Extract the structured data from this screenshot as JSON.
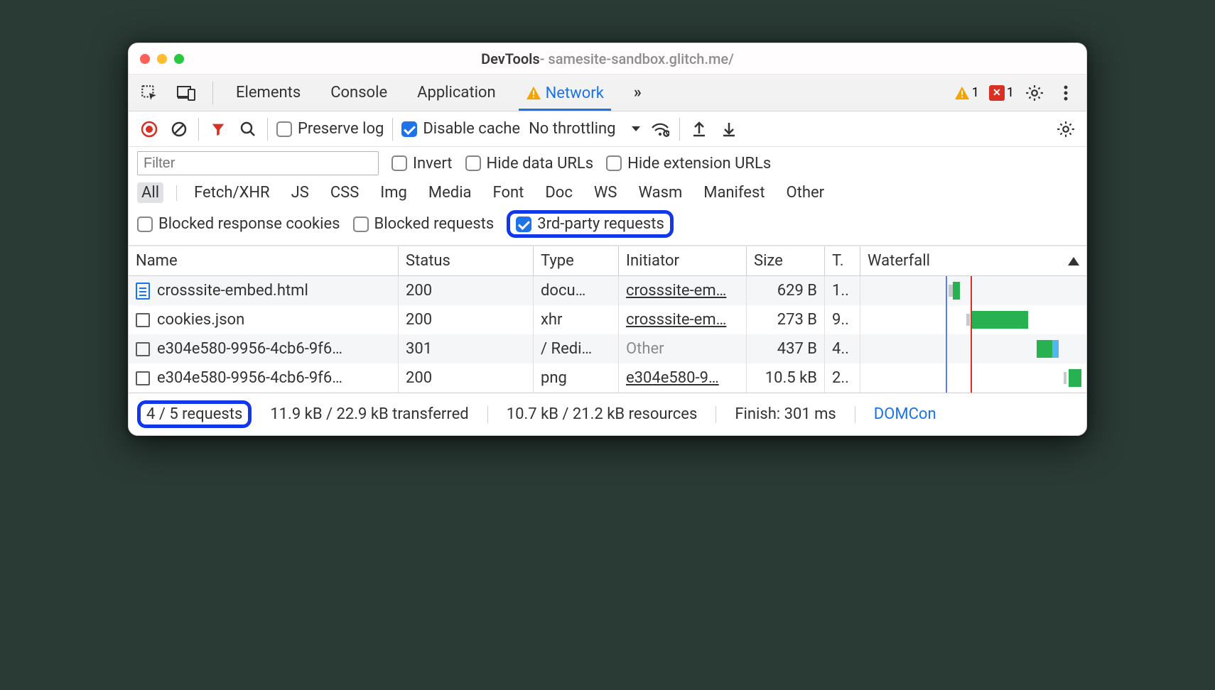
{
  "title": {
    "strong": "DevTools",
    "rest": " - samesite-sandbox.glitch.me/"
  },
  "tabs": {
    "elements": "Elements",
    "console": "Console",
    "application": "Application",
    "network": "Network",
    "more": "»"
  },
  "badges": {
    "warn_count": "1",
    "err_count": "1"
  },
  "net_toolbar": {
    "preserve_log": "Preserve log",
    "disable_cache": "Disable cache",
    "throttling": "No throttling"
  },
  "filter": {
    "placeholder": "Filter",
    "invert": "Invert",
    "hide_data": "Hide data URLs",
    "hide_ext": "Hide extension URLs",
    "types": [
      "All",
      "Fetch/XHR",
      "JS",
      "CSS",
      "Img",
      "Media",
      "Font",
      "Doc",
      "WS",
      "Wasm",
      "Manifest",
      "Other"
    ],
    "blocked_cookies": "Blocked response cookies",
    "blocked_req": "Blocked requests",
    "third_party": "3rd-party requests"
  },
  "headers": {
    "name": "Name",
    "status": "Status",
    "type": "Type",
    "initiator": "Initiator",
    "size": "Size",
    "time": "T.",
    "waterfall": "Waterfall"
  },
  "rows": [
    {
      "icon": "doc",
      "name": "crosssite-embed.html",
      "status": "200",
      "type": "docu…",
      "init": "crosssite-em…",
      "init_link": true,
      "size": "629 B",
      "time": "1.."
    },
    {
      "icon": "sq",
      "name": "cookies.json",
      "status": "200",
      "type": "xhr",
      "init": "crosssite-em…",
      "init_link": true,
      "size": "273 B",
      "time": "9.."
    },
    {
      "icon": "sq",
      "name": "e304e580-9956-4cb6-9f6…",
      "status": "301",
      "type": "/ Redi…",
      "init": "Other",
      "init_link": false,
      "size": "437 B",
      "time": "4.."
    },
    {
      "icon": "sq",
      "name": "e304e580-9956-4cb6-9f6…",
      "status": "200",
      "type": "png",
      "init": "e304e580-9…",
      "init_link": true,
      "size": "10.5 kB",
      "time": "2.."
    }
  ],
  "status": {
    "requests": "4 / 5 requests",
    "transferred": "11.9 kB / 22.9 kB transferred",
    "resources": "10.7 kB / 21.2 kB resources",
    "finish": "Finish: 301 ms",
    "domcontent": "DOMCon"
  }
}
